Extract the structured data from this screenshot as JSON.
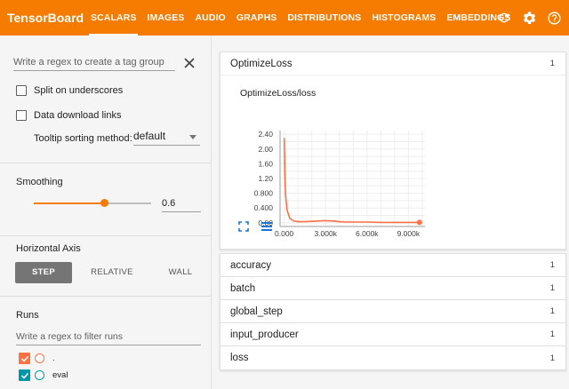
{
  "app": {
    "title": "TensorBoard"
  },
  "nav": {
    "tabs": [
      {
        "label": "SCALARS",
        "active": true
      },
      {
        "label": "IMAGES"
      },
      {
        "label": "AUDIO"
      },
      {
        "label": "GRAPHS"
      },
      {
        "label": "DISTRIBUTIONS"
      },
      {
        "label": "HISTOGRAMS"
      },
      {
        "label": "EMBEDDINGS"
      }
    ],
    "icons": [
      "refresh-icon",
      "settings-icon",
      "help-icon"
    ]
  },
  "sidebar": {
    "tag_filter": {
      "placeholder": "Write a regex to create a tag group"
    },
    "split_underscores": {
      "label": "Split on underscores",
      "checked": false
    },
    "data_download": {
      "label": "Data download links",
      "checked": false
    },
    "tooltip_sorting": {
      "label": "Tooltip sorting method:",
      "value": "default"
    },
    "smoothing": {
      "title": "Smoothing",
      "value": "0.6",
      "fraction": 0.6
    },
    "horizontal_axis": {
      "title": "Horizontal Axis",
      "options": [
        "STEP",
        "RELATIVE",
        "WALL"
      ],
      "selected": "STEP"
    },
    "runs": {
      "title": "Runs",
      "placeholder": "Write a regex to filter runs",
      "items": [
        {
          "label": ".",
          "color": "#ff7043",
          "checked": true
        },
        {
          "label": "eval",
          "color": "#0097a7",
          "checked": true
        }
      ]
    }
  },
  "main": {
    "expanded": {
      "name": "OptimizeLoss",
      "count": "1"
    },
    "collapsed": [
      {
        "name": "accuracy",
        "count": "1"
      },
      {
        "name": "batch",
        "count": "1"
      },
      {
        "name": "global_step",
        "count": "1"
      },
      {
        "name": "input_producer",
        "count": "1"
      },
      {
        "name": "loss",
        "count": "1"
      }
    ]
  },
  "chart_data": {
    "type": "line",
    "title": "OptimizeLoss/loss",
    "xlabel": "",
    "ylabel": "",
    "xlim": [
      -300,
      10200
    ],
    "ylim": [
      -0.1,
      2.5
    ],
    "x_ticks": [
      "0.000",
      "3.000k",
      "6.000k",
      "9.000k"
    ],
    "x_tick_values": [
      0,
      3000,
      6000,
      9000
    ],
    "y_ticks": [
      "0.00",
      "0.400",
      "0.800",
      "1.20",
      "1.60",
      "2.00",
      "2.40"
    ],
    "y_tick_values": [
      0,
      0.4,
      0.8,
      1.2,
      1.6,
      2.0,
      2.4
    ],
    "grid": true,
    "color": "#ff7043",
    "series": [
      {
        "x": [
          0,
          50,
          100,
          200,
          400,
          700,
          1000,
          1500,
          2000,
          2500,
          3000,
          3500,
          4000,
          4500,
          5000,
          6000,
          7000,
          8000,
          9000,
          9800
        ],
        "values": [
          2.3,
          1.3,
          0.75,
          0.35,
          0.12,
          0.05,
          0.03,
          0.03,
          0.04,
          0.05,
          0.06,
          0.05,
          0.03,
          0.02,
          0.02,
          0.02,
          0.01,
          0.01,
          0.01,
          0.01
        ]
      }
    ],
    "end_point": {
      "x": 9800,
      "y": 0.01
    }
  }
}
